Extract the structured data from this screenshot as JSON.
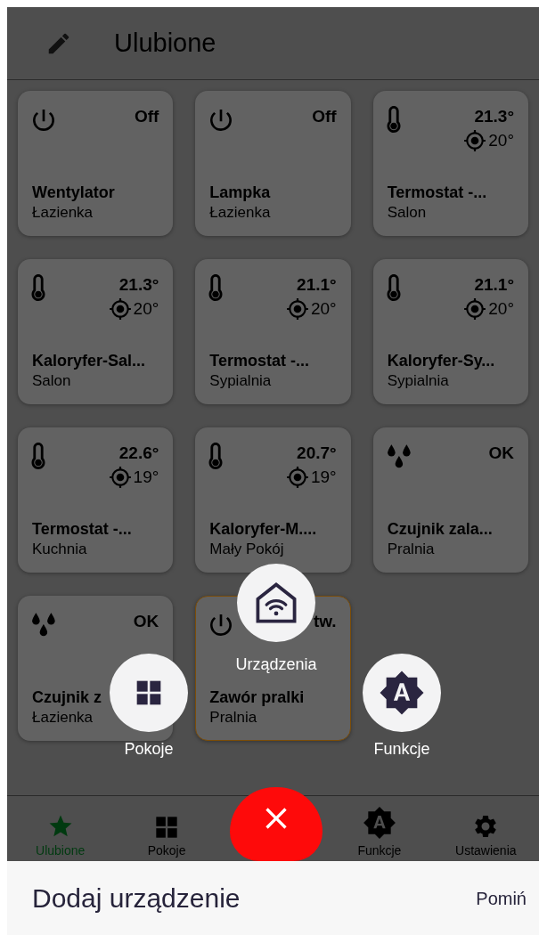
{
  "header": {
    "title": "Ulubione"
  },
  "cards": [
    {
      "kind": "switch",
      "value": "Off",
      "name": "Wentylator",
      "room": "Łazienka",
      "highlighted": false
    },
    {
      "kind": "switch",
      "value": "Off",
      "name": "Lampka",
      "room": "Łazienka",
      "highlighted": false
    },
    {
      "kind": "thermostat",
      "value": "21.3°",
      "target": "20°",
      "name": "Termostat -...",
      "room": "Salon",
      "highlighted": false
    },
    {
      "kind": "thermostat",
      "value": "21.3°",
      "target": "20°",
      "name": "Kaloryfer-Sal...",
      "room": "Salon",
      "highlighted": false
    },
    {
      "kind": "thermostat",
      "value": "21.1°",
      "target": "20°",
      "name": "Termostat -...",
      "room": "Sypialnia",
      "highlighted": false
    },
    {
      "kind": "thermostat",
      "value": "21.1°",
      "target": "20°",
      "name": "Kaloryfer-Sy...",
      "room": "Sypialnia",
      "highlighted": false
    },
    {
      "kind": "thermostat",
      "value": "22.6°",
      "target": "19°",
      "name": "Termostat -...",
      "room": "Kuchnia",
      "highlighted": false
    },
    {
      "kind": "thermostat",
      "value": "20.7°",
      "target": "19°",
      "name": "Kaloryfer-M....",
      "room": "Mały Pokój",
      "highlighted": false
    },
    {
      "kind": "leak",
      "value": "OK",
      "name": "Czujnik zala...",
      "room": "Pralnia",
      "highlighted": false
    },
    {
      "kind": "leak",
      "value": "OK",
      "name": "Czujnik z",
      "room": "Łazienka",
      "highlighted": false
    },
    {
      "kind": "switch",
      "value": "tw.",
      "name": "Zawór pralki",
      "room": "Pralnia",
      "highlighted": true
    }
  ],
  "fab_menu": [
    {
      "kind": "devices",
      "label": "Urządzenia"
    },
    {
      "kind": "rooms",
      "label": "Pokoje"
    },
    {
      "kind": "functions",
      "label": "Funkcje"
    }
  ],
  "bottom_nav": [
    {
      "kind": "favorites",
      "label": "Ulubione",
      "selected": true
    },
    {
      "kind": "rooms",
      "label": "Pokoje",
      "selected": false
    },
    {
      "kind": "functions",
      "label": "Funkcje",
      "selected": false
    },
    {
      "kind": "settings",
      "label": "Ustawienia",
      "selected": false
    }
  ],
  "sheet": {
    "title": "Dodaj urządzenie",
    "skip": "Pomiń"
  }
}
